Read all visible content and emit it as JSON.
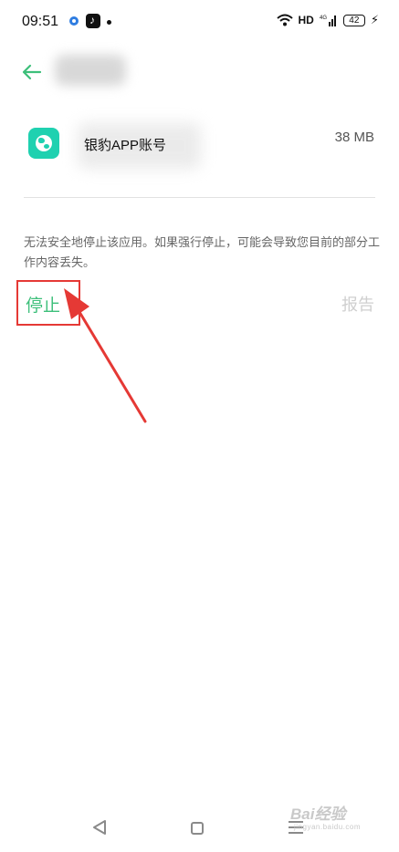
{
  "status_bar": {
    "time": "09:51",
    "network": "HD",
    "signal_label": "4G",
    "battery": "42",
    "notification_icons": [
      "ring-icon",
      "tiktok-icon",
      "dot-icon"
    ]
  },
  "header": {
    "back_icon": "arrow-left-icon",
    "accent_color": "#3dbf7a"
  },
  "app": {
    "icon": "globe-icon",
    "icon_color": "#1fd1b0",
    "name": "银豹APP账号",
    "size": "38 MB"
  },
  "warning": {
    "text": "无法安全地停止该应用。如果强行停止，可能会导致您目前的部分工作内容丢失。"
  },
  "actions": {
    "stop_label": "停止",
    "report_label": "报告"
  },
  "annotation": {
    "highlight_color": "#e53935"
  },
  "watermark": {
    "brand": "Bai经验",
    "sub": "jingyan.baidu.com"
  }
}
